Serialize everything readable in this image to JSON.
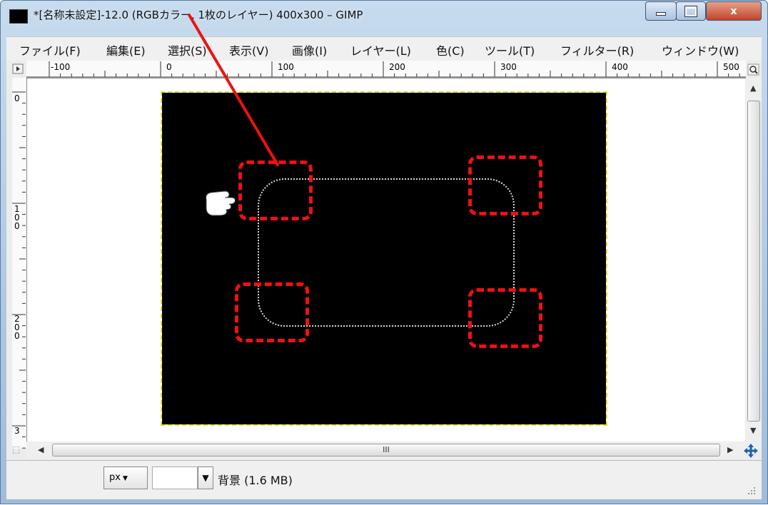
{
  "window": {
    "title": "*[名称未設定]-12.0 (RGBカラー, 1枚のレイヤー) 400x300 – GIMP",
    "close_label": "x"
  },
  "menus": [
    {
      "label": "ファイル(F)"
    },
    {
      "label": "編集(E)"
    },
    {
      "label": "選択(S)"
    },
    {
      "label": "表示(V)"
    },
    {
      "label": "画像(I)"
    },
    {
      "label": "レイヤー(L)"
    },
    {
      "label": "色(C)"
    },
    {
      "label": "ツール(T)"
    },
    {
      "label": "フィルター(R)"
    },
    {
      "label": "ウィンドウ(W)"
    }
  ],
  "ruler": {
    "h_labels": [
      "-100",
      "0",
      "100",
      "200",
      "300",
      "400",
      "500"
    ],
    "v_labels": [
      "0",
      "100",
      "200",
      "3"
    ]
  },
  "scroll": {
    "h_thumb_grip": "III"
  },
  "status": {
    "unit": "px",
    "layer_info": "背景 (1.6 MB)"
  },
  "colors": {
    "image_bg": "#000000",
    "annotation": "#ee1111",
    "selection": "#d8d8d8"
  }
}
